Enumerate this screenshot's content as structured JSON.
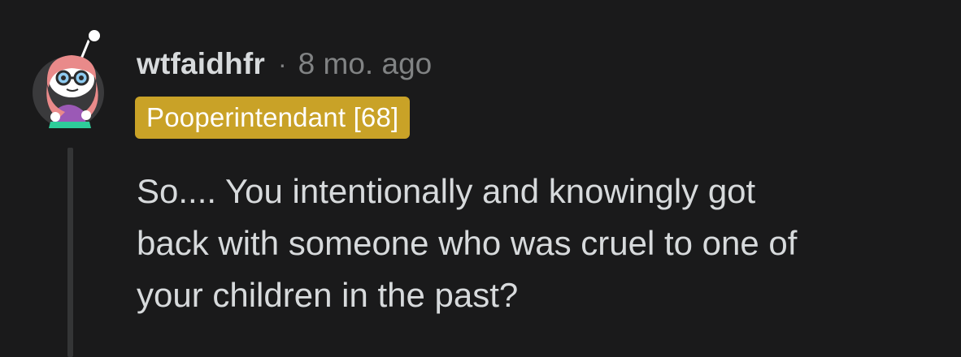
{
  "comment": {
    "username": "wtfaidhfr",
    "separator": "·",
    "timestamp": "8 mo. ago",
    "flair": "Pooperintendant [68]",
    "body_lines": [
      "So.... You intentionally and knowingly got",
      "back with someone who was cruel to one of",
      "your children in the past?"
    ]
  },
  "colors": {
    "background": "#1a1a1b",
    "text": "#d7dadc",
    "meta": "#818384",
    "flair_bg": "#c9a227",
    "thread_line": "#343536"
  },
  "icons": {
    "avatar": "snoo-avatar-icon"
  }
}
